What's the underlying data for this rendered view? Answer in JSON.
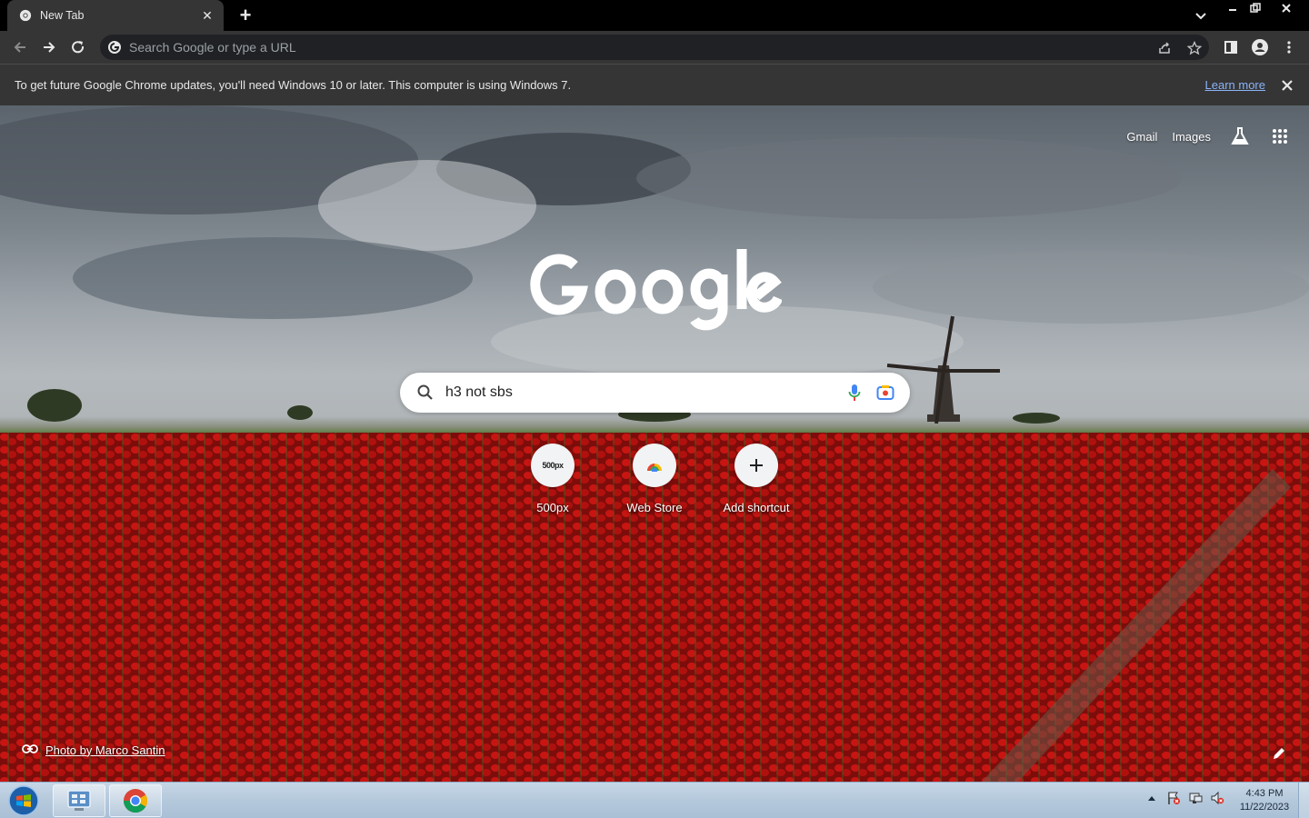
{
  "browser": {
    "tab_title": "New Tab",
    "omnibox_placeholder": "Search Google or type a URL"
  },
  "infobar": {
    "message": "To get future Google Chrome updates, you'll need Windows 10 or later. This computer is using Windows 7.",
    "learn_more": "Learn more"
  },
  "ntp": {
    "links": {
      "gmail": "Gmail",
      "images": "Images"
    },
    "search_value": "h3 not sbs",
    "shortcuts": [
      {
        "label": "500px",
        "icon_text": "500px"
      },
      {
        "label": "Web Store"
      },
      {
        "label": "Add shortcut"
      }
    ],
    "attribution": "Photo by Marco Santin"
  },
  "taskbar": {
    "time": "4:43 PM",
    "date": "11/22/2023"
  },
  "colors": {
    "chrome_dark": "#353535",
    "link_blue": "#8ab4f8",
    "taskbar": "#b5c9dc"
  }
}
